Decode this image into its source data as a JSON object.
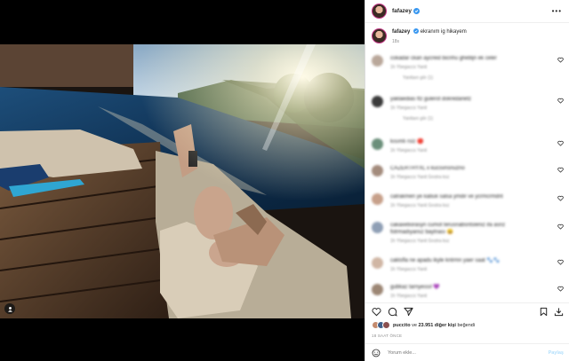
{
  "post": {
    "username": "fafazey",
    "caption_text": "ekranım ig hikayem",
    "caption_time": "18s"
  },
  "comments": [
    {
      "text": "cokadar ckan aycreid bicrihu ghebljn ek celer",
      "meta": "1h  Ybegaccs  Yanit",
      "sub": "Yanitaın gör (1)",
      "avatar_color": "#b9a79a"
    },
    {
      "text": "yaklaedias ftz gulerot dokredanetz",
      "meta": "1h  Ybegaccs  Yanit",
      "sub": "Yanitaın gör (1)",
      "avatar_color": "#3a3a3a"
    },
    {
      "text": "kısımlı rsiz 🔴",
      "meta": "1h  Ybegaccs  Yanit",
      "sub": "",
      "avatar_color": "#6b8f7a"
    },
    {
      "text": "CAZERTHYXL x kucsvnsnuzno",
      "meta": "1h  Ybegaccs  Yanit  Gostra ksz",
      "sub": "",
      "avatar_color": "#a38b7c"
    },
    {
      "text": "catrakmen ye kabuk salsa ymdir ve ycrmcrmdnt",
      "meta": "1h  Ybegaccs  Yanit  Gostra ksz",
      "sub": "",
      "avatar_color": "#c7a08a"
    },
    {
      "text": "cakaxeborasyn cumot terusnabsntsleniz ifa asnz",
      "meta": "fotrmadıyansz baytnası 😀",
      "sub": "1h  Ybegaccs  Yanit  Gostra ksz",
      "avatar_color": "#8f9fb5"
    },
    {
      "text": "cakisfla ne apadu ikyle kntrmn yaer saat 🐾🐾",
      "meta": "1h  Ybegaccs  Yanit",
      "sub": "",
      "avatar_color": "#d0b6a4"
    },
    {
      "text": "gubkaz tarnyessıl 💜",
      "meta": "1h  Ybegaccs  Yanit",
      "sub": "",
      "avatar_color": "#9c8674"
    }
  ],
  "likes": {
    "first_user": "puccito",
    "connector": " ve ",
    "others": "23.951 diğer kişi",
    "suffix": " beğendi"
  },
  "post_time": "18 SAAT ÖNCE",
  "add_comment": {
    "placeholder": "Yorum ekle...",
    "post_label": "Paylaş"
  },
  "colors": {
    "accent": "#3897f0",
    "text": "#262626",
    "muted": "#8e8e8e"
  },
  "icons": {
    "like": "heart-icon",
    "comment": "comment-icon",
    "share": "send-icon",
    "save": "bookmark-icon",
    "download": "download-icon",
    "emoji": "smile-icon",
    "more": "more-icon"
  }
}
